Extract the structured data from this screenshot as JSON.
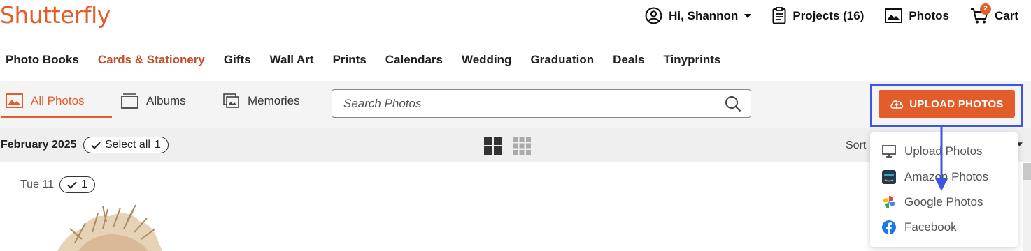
{
  "brand": {
    "logo_text": "Shutterfly",
    "accent": "#e35d2b",
    "highlight": "#3d55e6"
  },
  "header": {
    "greeting": "Hi, Shannon",
    "projects_label": "Projects (16)",
    "photos_label": "Photos",
    "cart_label": "Cart",
    "cart_count": "2"
  },
  "nav": {
    "items": [
      "Photo Books",
      "Cards & Stationery",
      "Gifts",
      "Wall Art",
      "Prints",
      "Calendars",
      "Wedding",
      "Graduation",
      "Deals",
      "Tinyprints"
    ],
    "active_index": 1
  },
  "toolbar": {
    "tabs": [
      {
        "label": "All Photos",
        "icon": "image-icon",
        "active": true
      },
      {
        "label": "Albums",
        "icon": "album-icon",
        "active": false
      },
      {
        "label": "Memories",
        "icon": "memories-icon",
        "active": false
      }
    ],
    "search_placeholder": "Search Photos",
    "upload_label": "UPLOAD PHOTOS"
  },
  "date_row": {
    "month_label": "February 2025",
    "select_all_label": "Select all",
    "select_all_count": "1",
    "sort_label": "Sort"
  },
  "content": {
    "day_label": "Tue 11",
    "day_count": "1"
  },
  "upload_menu": {
    "items": [
      {
        "label": "Upload Photos",
        "icon": "monitor-icon"
      },
      {
        "label": "Amazon Photos",
        "icon": "amazon-photos-icon"
      },
      {
        "label": "Google Photos",
        "icon": "google-photos-icon"
      },
      {
        "label": "Facebook",
        "icon": "facebook-icon"
      }
    ]
  }
}
